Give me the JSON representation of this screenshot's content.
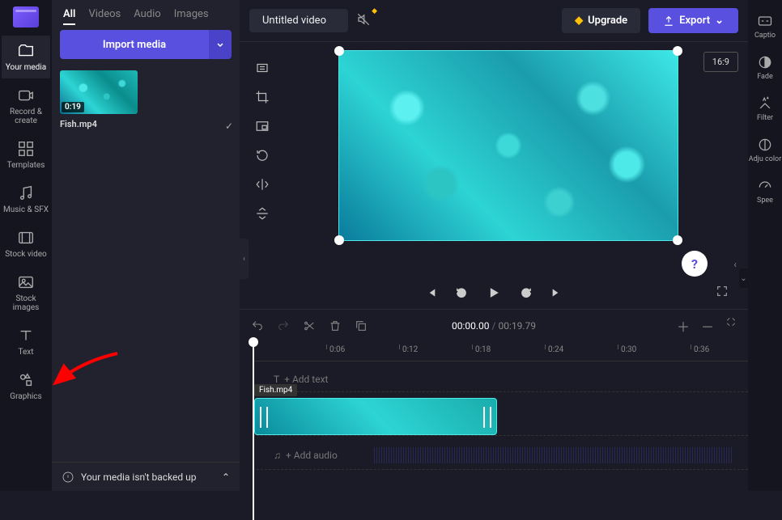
{
  "leftnav": {
    "items": [
      {
        "label": "Your media",
        "icon": "folder",
        "active": true
      },
      {
        "label": "Record & create",
        "icon": "camera"
      },
      {
        "label": "Templates",
        "icon": "templates"
      },
      {
        "label": "Music & SFX",
        "icon": "music"
      },
      {
        "label": "Stock video",
        "icon": "film"
      },
      {
        "label": "Stock images",
        "icon": "image"
      },
      {
        "label": "Text",
        "icon": "text"
      },
      {
        "label": "Graphics",
        "icon": "shapes"
      }
    ]
  },
  "media_panel": {
    "tabs": [
      "All",
      "Videos",
      "Audio",
      "Images"
    ],
    "active_tab": "All",
    "import_label": "Import media",
    "clip": {
      "duration": "0:19",
      "name": "Fish.mp4"
    },
    "backup_msg": "Your media isn't backed up"
  },
  "topbar": {
    "title": "Untitled video",
    "upgrade": "Upgrade",
    "export": "Export"
  },
  "preview": {
    "ratio": "16:9"
  },
  "playbar": {
    "current": "00:00.00",
    "total": "00:19.79"
  },
  "ruler_ticks": [
    "0:06",
    "0:12",
    "0:18",
    "0:24",
    "0:30",
    "0:36"
  ],
  "timeline": {
    "add_text": "+ Add text",
    "add_audio": "+ Add audio",
    "clip_name": "Fish.mp4"
  },
  "rightrail": {
    "items": [
      {
        "label": "Captio",
        "icon": "cc"
      },
      {
        "label": "Fade",
        "icon": "fade"
      },
      {
        "label": "Filter",
        "icon": "wand"
      },
      {
        "label": "Adju color",
        "icon": "contrast"
      },
      {
        "label": "Spee",
        "icon": "speed"
      }
    ]
  }
}
